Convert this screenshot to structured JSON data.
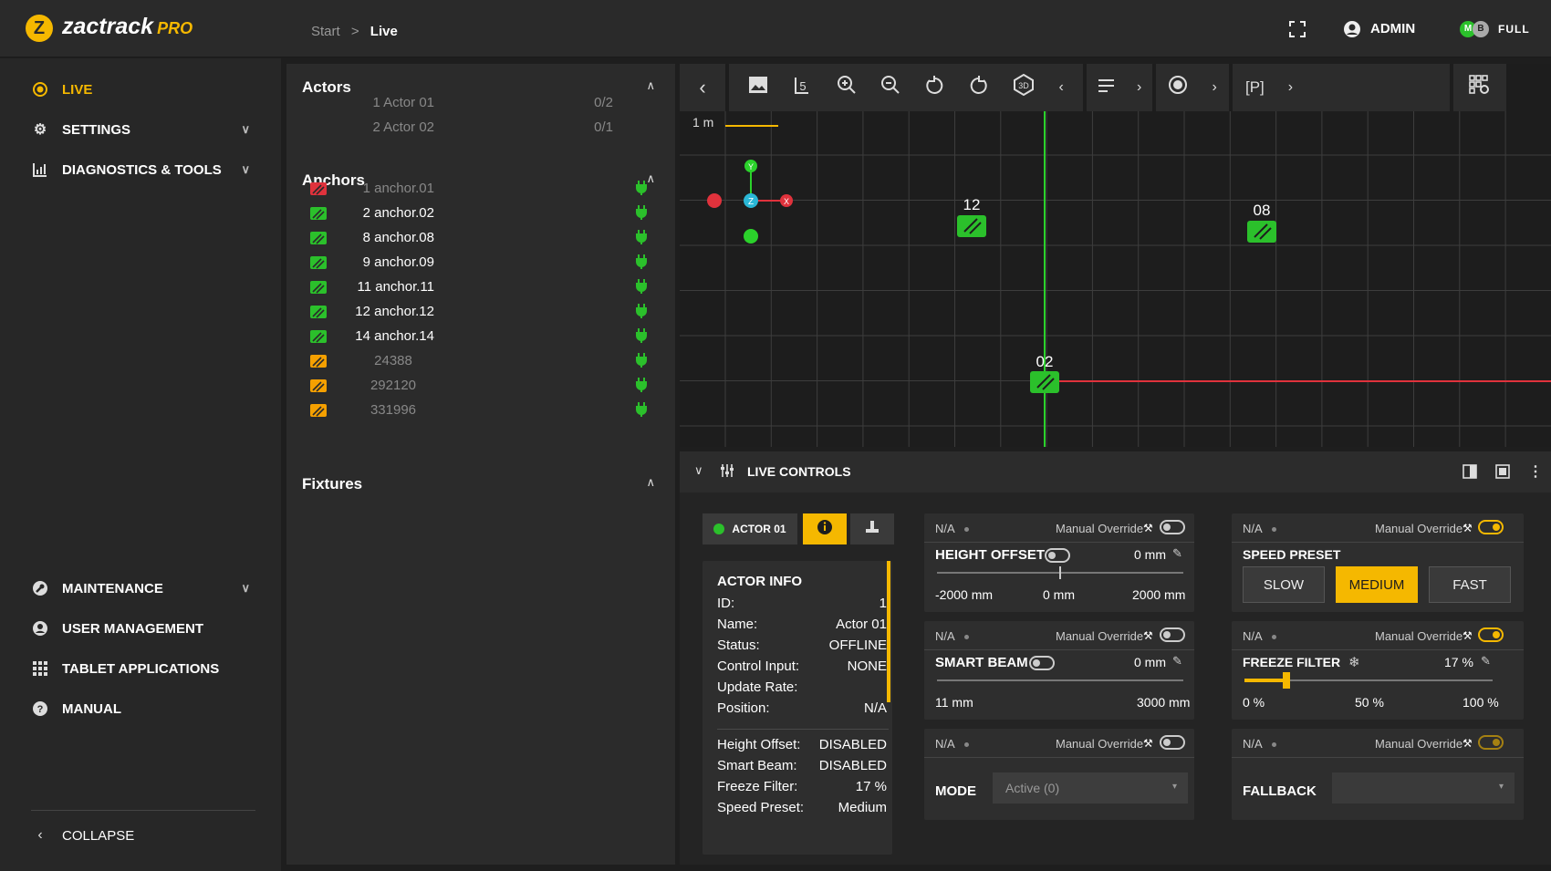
{
  "header": {
    "brand": "zactrack",
    "brand_suffix": "PRO",
    "crumb_start": "Start",
    "crumb_sep": ">",
    "crumb_current": "Live",
    "user": "ADMIN",
    "mode": "FULL",
    "mode_badge_1": "M",
    "mode_badge_2": "B"
  },
  "nav": {
    "live": "LIVE",
    "settings": "SETTINGS",
    "diagnostics": "DIAGNOSTICS & TOOLS",
    "maintenance": "MAINTENANCE",
    "user_management": "USER MANAGEMENT",
    "tablet_apps": "TABLET APPLICATIONS",
    "manual": "MANUAL",
    "collapse": "COLLAPSE"
  },
  "actors": {
    "title": "Actors",
    "items": [
      {
        "name": "1 Actor 01",
        "count": "0/2"
      },
      {
        "name": "2 Actor 02",
        "count": "0/1"
      }
    ]
  },
  "anchors": {
    "title": "Anchors",
    "items": [
      {
        "name": "1 anchor.01",
        "color": "#e0323c",
        "dim": true
      },
      {
        "name": "2 anchor.02",
        "color": "#2bc02b",
        "dim": false
      },
      {
        "name": "8 anchor.08",
        "color": "#2bc02b",
        "dim": false
      },
      {
        "name": "9 anchor.09",
        "color": "#2bc02b",
        "dim": false
      },
      {
        "name": "11 anchor.11",
        "color": "#2bc02b",
        "dim": false
      },
      {
        "name": "12 anchor.12",
        "color": "#2bc02b",
        "dim": false
      },
      {
        "name": "14 anchor.14",
        "color": "#2bc02b",
        "dim": false
      },
      {
        "name": "24388",
        "color": "#f5a000",
        "dim": true
      },
      {
        "name": "292120",
        "color": "#f5a000",
        "dim": true
      },
      {
        "name": "331996",
        "color": "#f5a000",
        "dim": true
      }
    ]
  },
  "fixtures": {
    "title": "Fixtures"
  },
  "viewport": {
    "scale_label": "1 m",
    "axis_x": "X",
    "axis_y": "Y",
    "axis_z": "Z",
    "marker_12": "12",
    "marker_08": "08",
    "marker_02": "02",
    "toolbar_p": "[P]"
  },
  "live_controls": {
    "title": "LIVE CONTROLS",
    "actor_tab": "ACTOR 01",
    "info": {
      "title": "ACTOR INFO",
      "rows": [
        {
          "k": "ID:",
          "v": "1"
        },
        {
          "k": "Name:",
          "v": "Actor 01"
        },
        {
          "k": "Status:",
          "v": "OFFLINE"
        },
        {
          "k": "Control Input:",
          "v": "NONE"
        },
        {
          "k": "Update Rate:",
          "v": ""
        },
        {
          "k": "Position:",
          "v": "N/A"
        }
      ],
      "rows2": [
        {
          "k": "Height Offset:",
          "v": "DISABLED"
        },
        {
          "k": "Smart Beam:",
          "v": "DISABLED"
        },
        {
          "k": "Freeze Filter:",
          "v": "17 %"
        },
        {
          "k": "Speed Preset:",
          "v": "Medium"
        }
      ]
    },
    "na": "N/A",
    "manual_override": "Manual Override",
    "height_offset": {
      "label": "HEIGHT OFFSET",
      "value": "0 mm",
      "min": "-2000 mm",
      "mid": "0 mm",
      "max": "2000 mm"
    },
    "smart_beam": {
      "label": "SMART BEAM",
      "value": "0 mm",
      "min": "11 mm",
      "max": "3000 mm"
    },
    "mode": {
      "label": "MODE",
      "value": "Active (0)"
    },
    "speed_preset": {
      "label": "SPEED PRESET",
      "slow": "SLOW",
      "medium": "MEDIUM",
      "fast": "FAST"
    },
    "freeze_filter": {
      "label": "FREEZE FILTER",
      "value": "17 %",
      "level": 0.17,
      "min": "0 %",
      "mid": "50 %",
      "max": "100 %"
    },
    "fallback": {
      "label": "FALLBACK",
      "value": ""
    }
  }
}
